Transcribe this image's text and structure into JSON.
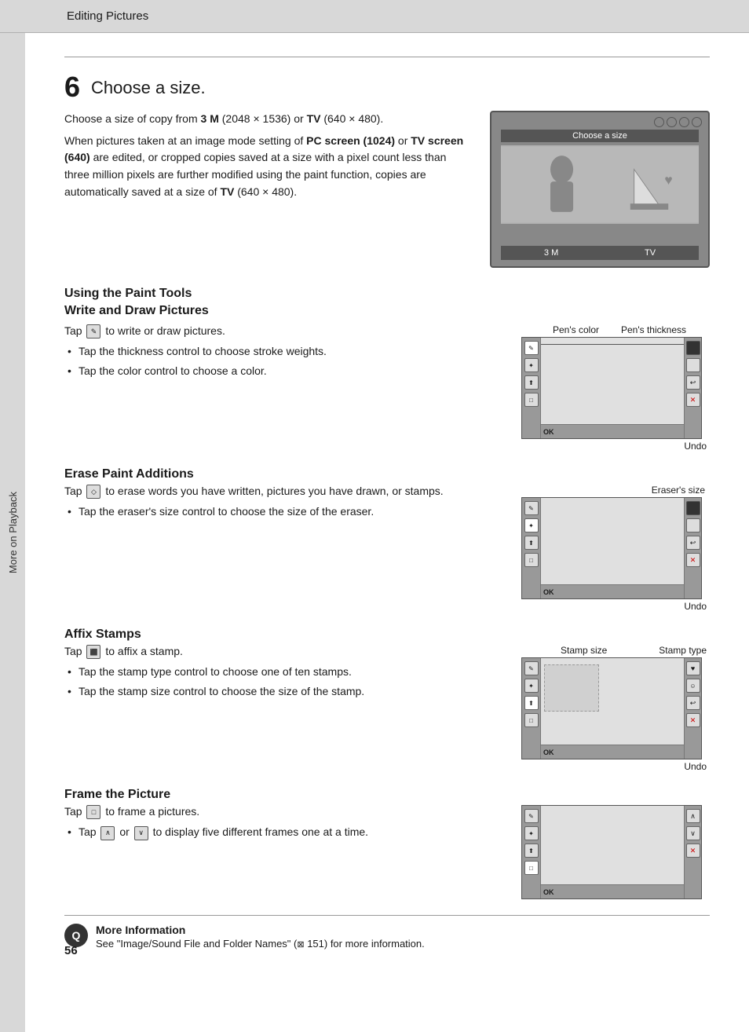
{
  "header": {
    "title": "Editing Pictures"
  },
  "sidebar": {
    "label": "More on Playback"
  },
  "page_number": "56",
  "step6": {
    "number": "6",
    "heading": "Choose a size.",
    "body1": "Choose a size of copy from ",
    "bold1": "3 M",
    "body1b": " (2048 × 1536) or ",
    "bold2": "TV",
    "body1c": " (640 × 480).",
    "body2": "When pictures taken at an image mode setting of ",
    "bold3": "PC screen (1024)",
    "body2b": " or ",
    "bold4": "TV screen (640)",
    "body2c": " are edited, or cropped copies saved at a size with a pixel count less than three million pixels are further modified using the paint function, copies are automatically saved at a size of ",
    "bold5": "TV",
    "body2d": " (640 × 480).",
    "camera_label": "Choose a size",
    "camera_option1": "3 M",
    "camera_option2": "TV"
  },
  "paint_tools": {
    "heading1": "Using the Paint Tools",
    "heading2": "Write and Draw Pictures",
    "intro": "Tap ",
    "icon_pencil": "✎",
    "intro2": " to write or draw pictures.",
    "bullets": [
      "Tap the thickness control to choose stroke weights.",
      "Tap the color control to choose a color."
    ],
    "diagram1": {
      "label_left": "Pen's color",
      "label_right": "Pen's thickness",
      "undo_label": "Undo",
      "tools_left": [
        "✎",
        "✦",
        "⬆",
        "□"
      ],
      "ok_label": "OK"
    }
  },
  "erase_section": {
    "heading": "Erase Paint Additions",
    "intro": "Tap ",
    "icon_eraser": "◇",
    "intro2": " to erase words you have written, pictures you have drawn, or stamps.",
    "bullets": [
      "Tap the eraser's size control to choose the size of the eraser."
    ],
    "diagram2": {
      "undo_label": "Undo",
      "eraser_label": "Eraser's size",
      "tools_left": [
        "✎",
        "✦",
        "⬆",
        "□"
      ],
      "ok_label": "OK"
    }
  },
  "stamp_section": {
    "heading": "Affix Stamps",
    "intro": "Tap ",
    "icon_stamp": "⬛",
    "intro2": " to affix a stamp.",
    "bullets": [
      "Tap the stamp type control to choose one of ten stamps.",
      "Tap the stamp size control to choose the size of the stamp."
    ],
    "diagram3": {
      "stamp_size_label": "Stamp size",
      "stamp_type_label": "Stamp type",
      "undo_label": "Undo",
      "tools_left": [
        "✎",
        "✦",
        "⬆",
        "□"
      ],
      "ok_label": "OK"
    }
  },
  "frame_section": {
    "heading": "Frame the Picture",
    "intro": "Tap ",
    "icon_frame": "□",
    "intro2": " to frame a pictures.",
    "bullets": [
      "Tap  ∧  or  ∨  to display five different frames one at a time."
    ],
    "diagram4": {
      "tools_left": [
        "✎",
        "✦",
        "⬆",
        "□"
      ],
      "ok_label": "OK"
    }
  },
  "more_info": {
    "icon": "Q",
    "heading": "More Information",
    "body": "See \"Image/Sound File and Folder Names\" (",
    "icon_book": "⊠",
    "body2": " 151) for more information."
  }
}
